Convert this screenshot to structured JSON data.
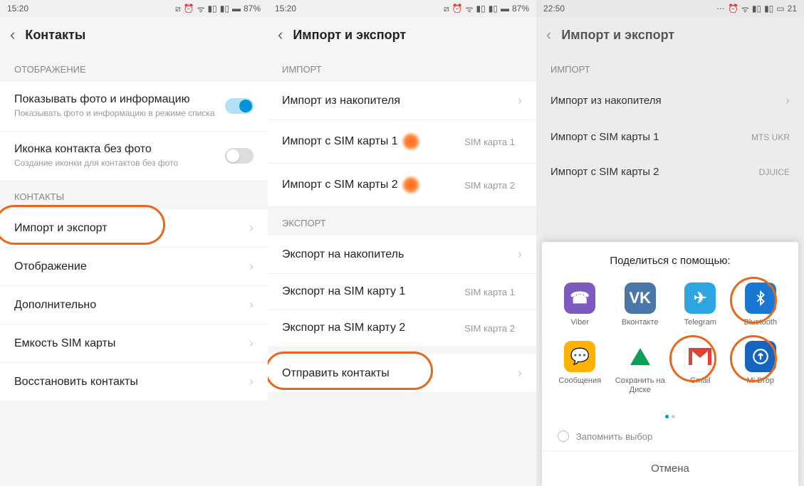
{
  "screen1": {
    "status": {
      "time": "15:20",
      "battery": "87%"
    },
    "header": {
      "title": "Контакты"
    },
    "sections": {
      "display_label": "ОТОБРАЖЕНИЕ",
      "contacts_label": "КОНТАКТЫ"
    },
    "rows": {
      "show_photo": {
        "title": "Показывать фото и информацию",
        "sub": "Показывать фото и информацию в режиме списка"
      },
      "icon_no_photo": {
        "title": "Иконка контакта без фото",
        "sub": "Создание иконки для контактов без фото"
      },
      "import_export": {
        "title": "Импорт и экспорт"
      },
      "display": {
        "title": "Отображение"
      },
      "more": {
        "title": "Дополнительно"
      },
      "sim_cap": {
        "title": "Емкость SIM карты"
      },
      "restore": {
        "title": "Восстановить контакты"
      }
    }
  },
  "screen2": {
    "status": {
      "time": "15:20",
      "battery": "87%"
    },
    "header": {
      "title": "Импорт и экспорт"
    },
    "sections": {
      "import": "ИМПОРТ",
      "export": "ЭКСПОРТ"
    },
    "rows": {
      "import_storage": {
        "title": "Импорт из накопителя"
      },
      "import_sim1": {
        "title": "Импорт с SIM карты 1",
        "detail": "SIM карта 1"
      },
      "import_sim2": {
        "title": "Импорт с SIM карты 2",
        "detail": "SIM карта 2"
      },
      "export_storage": {
        "title": "Экспорт на накопитель"
      },
      "export_sim1": {
        "title": "Экспорт на SIM карту 1",
        "detail": "SIM карта 1"
      },
      "export_sim2": {
        "title": "Экспорт на SIM карту 2",
        "detail": "SIM карта 2"
      },
      "send": {
        "title": "Отправить контакты"
      }
    }
  },
  "screen3": {
    "status": {
      "time": "22:50",
      "battery": "21"
    },
    "header": {
      "title": "Импорт и экспорт"
    },
    "sections": {
      "import": "ИМПОРТ"
    },
    "rows": {
      "import_storage": {
        "title": "Импорт из накопителя"
      },
      "import_sim1": {
        "title": "Импорт с SIM карты 1",
        "detail": "MTS UKR"
      },
      "import_sim2": {
        "title": "Импорт с SIM карты 2",
        "detail": "DJUICE"
      }
    },
    "share": {
      "title": "Поделиться с помощью:",
      "items": [
        "Viber",
        "Вконтакте",
        "Telegram",
        "Bluetooth",
        "Сообщения",
        "Сохранить на Диске",
        "Gmail",
        "Mi Drop"
      ],
      "remember": "Запомнить выбор",
      "cancel": "Отмена"
    }
  }
}
